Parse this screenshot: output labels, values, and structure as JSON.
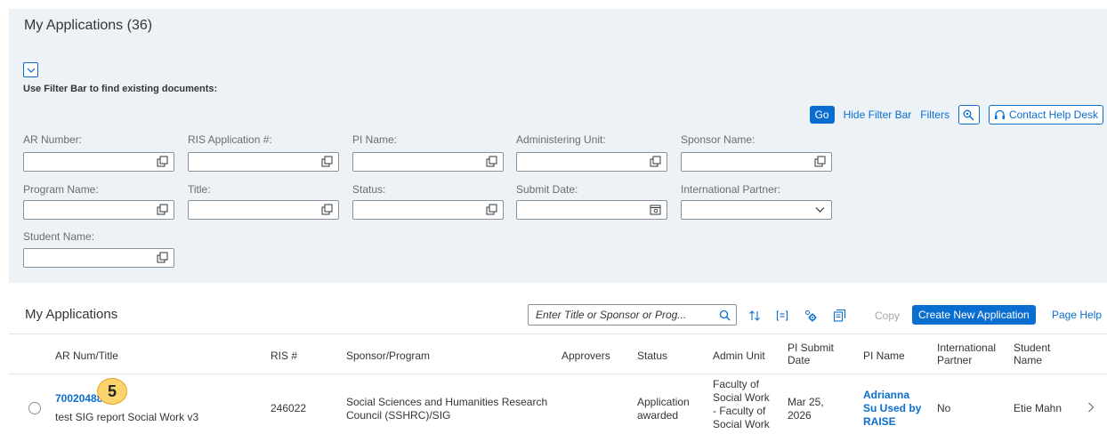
{
  "page": {
    "title": "My Applications (36)"
  },
  "filter_bar": {
    "hint": "Use Filter Bar to find existing documents:",
    "go_label": "Go",
    "hide_label": "Hide Filter Bar",
    "filters_label": "Filters",
    "help_desk_label": "Contact Help Desk",
    "fields": {
      "ar_number": "AR Number:",
      "ris_app": "RIS Application #:",
      "pi_name": "PI Name:",
      "admin_unit": "Administering Unit:",
      "sponsor": "Sponsor Name:",
      "program": "Program Name:",
      "title": "Title:",
      "status": "Status:",
      "submit_date": "Submit Date:",
      "intl_partner": "International Partner:",
      "student": "Student Name:"
    }
  },
  "table": {
    "title": "My Applications",
    "search_placeholder": "Enter Title or Sponsor or Prog...",
    "copy_label": "Copy",
    "create_label": "Create New Application",
    "page_help_label": "Page Help",
    "columns": {
      "ar": "AR Num/Title",
      "ris": "RIS #",
      "sponsor": "Sponsor/Program",
      "approvers": "Approvers",
      "status": "Status",
      "admin_unit": "Admin Unit",
      "pi_submit": "PI Submit Date",
      "pi_name": "PI Name",
      "intl": "International Partner",
      "student": "Student Name"
    },
    "rows": [
      {
        "ar_num": "70020488",
        "ar_title": "test SIG report Social Work v3",
        "ris": "246022",
        "sponsor": "Social Sciences and Humanities Research Council (SSHRC)/SIG",
        "approvers": "",
        "status": "Application awarded",
        "admin_unit": "Faculty of Social Work - Faculty of Social Work",
        "pi_submit": "Mar 25, 2026",
        "pi_name": "Adrianna Su Used by RAISE",
        "intl": "No",
        "student": "Etie Mahn"
      }
    ]
  },
  "annotation": {
    "step_number": "5"
  },
  "colors": {
    "accent": "#0a6ed1",
    "panel_bg": "#edf2f7",
    "badge": "#fbd46d"
  }
}
